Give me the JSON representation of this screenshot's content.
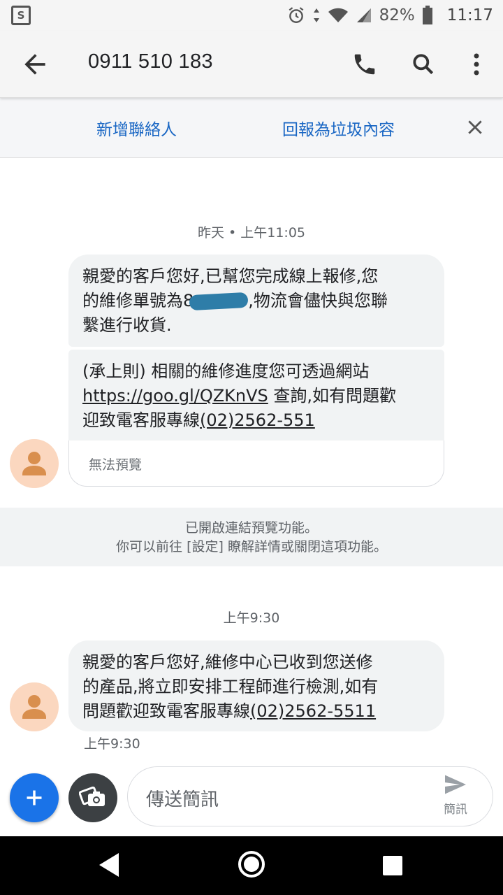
{
  "status_bar": {
    "app_icon_label": "S",
    "battery": "82%",
    "time": "11:17"
  },
  "header": {
    "title": "0911 510 183"
  },
  "actions": {
    "add_contact": "新增聯絡人",
    "report_spam": "回報為垃圾內容"
  },
  "messages": {
    "group1": {
      "timestamp": "昨天 • 上午11:05",
      "msg1": {
        "line1": "親愛的客戶您好,已幫您完成線上報修,您",
        "line2_before": "的維修單號為8",
        "line2_after": ",物流會儘快與您聯",
        "line3": "繫進行收貨."
      },
      "msg2": {
        "line1": "(承上則)  相關的維修進度您可透過網站",
        "link": "https://goo.gl/QZKnVS",
        "line2_after": " 查詢,如有問題歡",
        "line3_before": "迎致電客服專線",
        "phone": "(02)2562-551"
      },
      "preview_unavailable": "無法預覽"
    },
    "notice": {
      "line1": "已開啟連結預覽功能。",
      "line2": "你可以前往 [設定] 瞭解詳情或關閉這項功能。"
    },
    "group2": {
      "timestamp": "上午9:30",
      "msg3": {
        "line1": "親愛的客戶您好,維修中心已收到您送修",
        "line2": "的產品,將立即安排工程師進行檢測,如有",
        "line3_before": "問題歡迎致電客服專線",
        "phone": "(02)2562-5511"
      },
      "sent_time": "上午9:30"
    }
  },
  "compose": {
    "placeholder": "傳送簡訊",
    "send_label": "簡訊"
  },
  "colors": {
    "accent": "#1a73e8",
    "link_text": "#1a67c4",
    "bubble": "#f1f3f4",
    "avatar_bg": "#fbd7bf",
    "avatar_fg": "#d98f4e"
  },
  "icons": [
    "app-icon",
    "alarm-icon",
    "signal-icon",
    "wifi-icon",
    "battery-icon",
    "back-arrow-icon",
    "phone-icon",
    "search-icon",
    "more-vert-icon",
    "close-icon",
    "contact-avatar-icon",
    "plus-icon",
    "camera-gallery-icon",
    "send-icon",
    "nav-back-icon",
    "nav-home-icon",
    "nav-recent-icon"
  ]
}
